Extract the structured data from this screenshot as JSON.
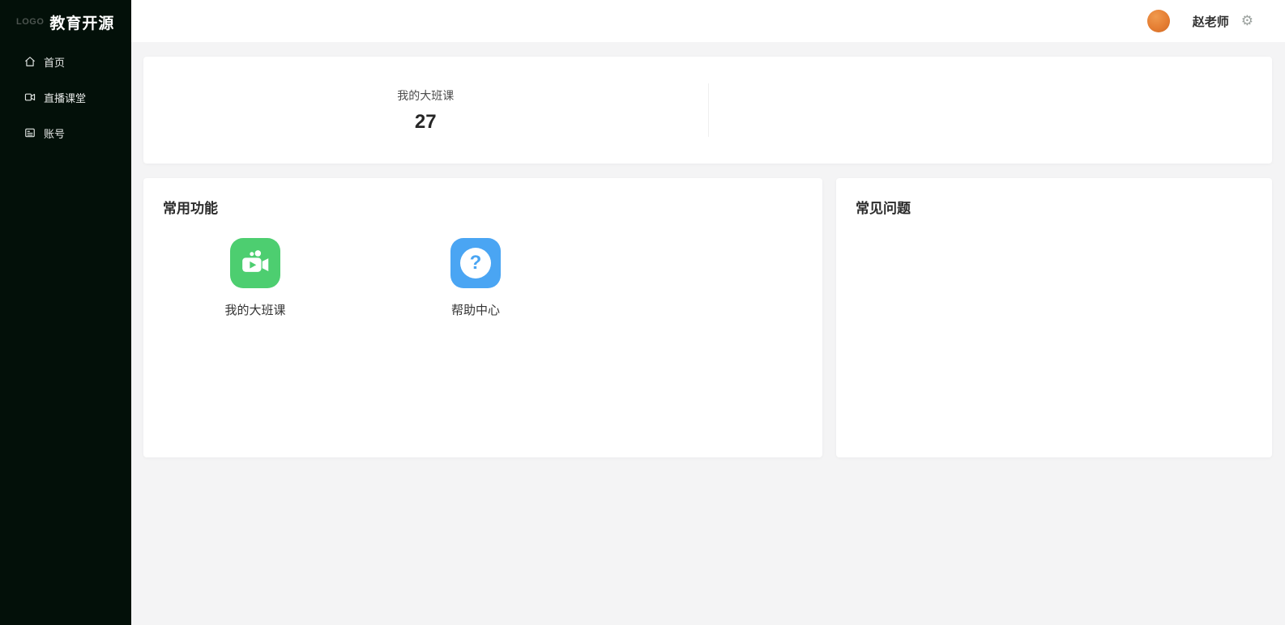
{
  "sidebar": {
    "logo_prefix": "LOGO",
    "logo_title": "教育开源",
    "items": [
      {
        "label": "首页",
        "icon": "home-icon"
      },
      {
        "label": "直播课堂",
        "icon": "live-classroom-icon"
      },
      {
        "label": "账号",
        "icon": "account-icon"
      }
    ]
  },
  "header": {
    "user_name": "赵老师",
    "settings_icon": "⚙"
  },
  "stats": {
    "items": [
      {
        "label": "我的大班课",
        "value": "27"
      }
    ]
  },
  "quick_actions": {
    "title": "常用功能",
    "items": [
      {
        "label": "我的大班课",
        "icon": "video-camera-icon",
        "color": "#4dce70"
      },
      {
        "label": "帮助中心",
        "icon": "question-icon",
        "color": "#4aa5f3"
      }
    ]
  },
  "faq": {
    "title": "常见问题"
  },
  "colors": {
    "sidebar_bg": "#031009",
    "content_bg": "#f4f4f5",
    "accent_green": "#4dce70",
    "accent_blue": "#4aa5f3",
    "avatar_orange": "#e57e33"
  }
}
